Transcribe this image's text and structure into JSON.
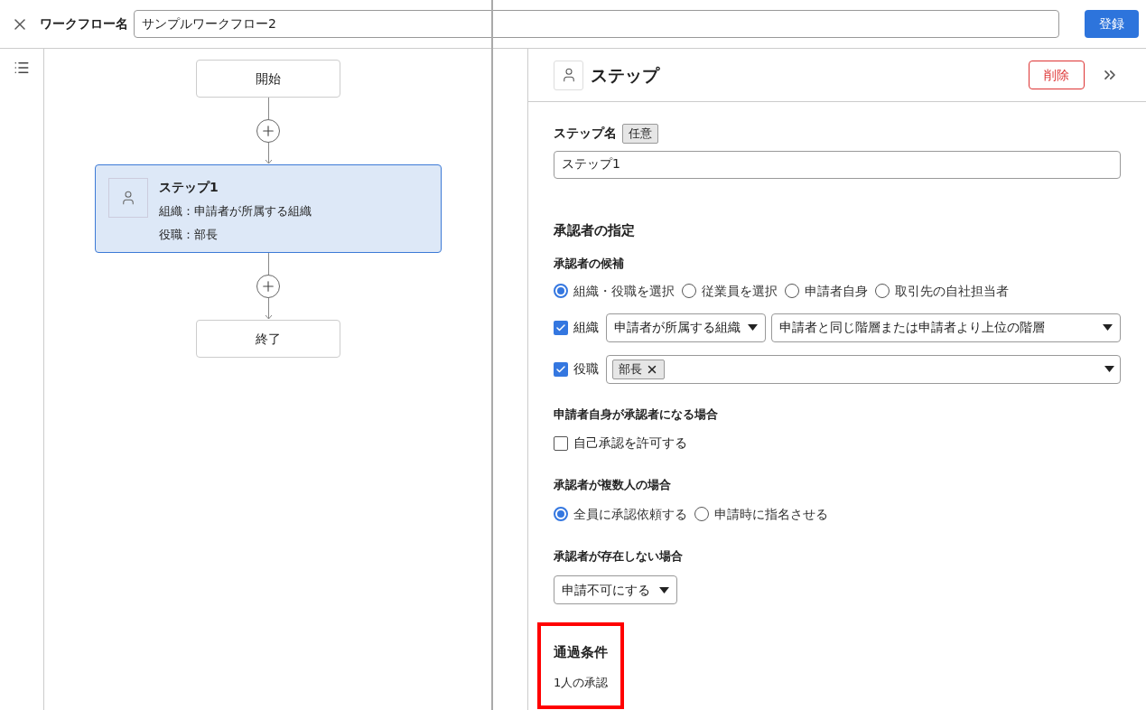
{
  "header": {
    "name_label": "ワークフロー名",
    "name_value": "サンプルワークフロー2",
    "submit": "登録"
  },
  "flow": {
    "start": "開始",
    "steps": [
      {
        "title": "ステップ1",
        "lines": [
          "組織：申請者が所属する組織",
          "役職：部長"
        ],
        "selected": true
      }
    ],
    "end": "終了"
  },
  "panel": {
    "title": "ステップ",
    "delete": "削除",
    "step_name": {
      "label": "ステップ名",
      "badge": "任意",
      "value": "ステップ1"
    },
    "approver": {
      "heading": "承認者の指定",
      "candidates_label": "承認者の候補",
      "options": [
        {
          "label": "組織・役職を選択",
          "selected": true
        },
        {
          "label": "従業員を選択",
          "selected": false
        },
        {
          "label": "申請者自身",
          "selected": false
        },
        {
          "label": "取引先の自社担当者",
          "selected": false
        }
      ],
      "filters": [
        {
          "kind": "select",
          "label": "組織",
          "checked": true,
          "selects": [
            "申請者が所属する組織",
            "申請者と同じ階層または申請者より上位の階層"
          ]
        },
        {
          "kind": "tags",
          "label": "役職",
          "checked": true,
          "tags": [
            "部長"
          ]
        }
      ]
    },
    "self_approval": {
      "heading": "申請者自身が承認者になる場合",
      "label": "自己承認を許可する",
      "checked": false
    },
    "multiple": {
      "heading": "承認者が複数人の場合",
      "options": [
        {
          "label": "全員に承認依頼する",
          "selected": true
        },
        {
          "label": "申請時に指名させる",
          "selected": false
        }
      ]
    },
    "absent": {
      "heading": "承認者が存在しない場合",
      "value": "申請不可にする"
    },
    "pass": {
      "heading": "通過条件",
      "text": "1人の承認",
      "highlighted": true
    }
  }
}
